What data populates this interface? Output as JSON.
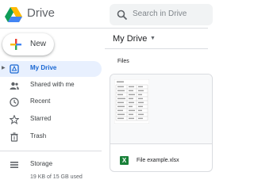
{
  "app": {
    "title": "Drive"
  },
  "search": {
    "placeholder": "Search in Drive"
  },
  "new_button": {
    "label": "New"
  },
  "sidebar": {
    "items": [
      {
        "label": "My Drive",
        "icon": "drive-icon",
        "active": true
      },
      {
        "label": "Shared with me",
        "icon": "people-icon"
      },
      {
        "label": "Recent",
        "icon": "clock-icon"
      },
      {
        "label": "Starred",
        "icon": "star-icon"
      },
      {
        "label": "Trash",
        "icon": "trash-icon"
      }
    ],
    "storage": {
      "label": "Storage",
      "icon": "storage-icon",
      "usage": "19 KB of 15 GB used"
    }
  },
  "main": {
    "title": "My Drive",
    "section": "Files",
    "files": [
      {
        "name": "File example.xlsx",
        "icon": "sheets-icon",
        "icon_letter": "X"
      }
    ]
  },
  "colors": {
    "accent": "#1967d2",
    "active_bg": "#e8f0fe",
    "sheets_green": "#188038"
  }
}
